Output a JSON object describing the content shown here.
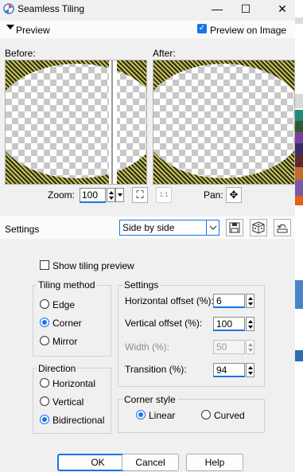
{
  "window": {
    "title": "Seamless Tiling",
    "minimize": "—",
    "maximize": "☐",
    "close": "✕"
  },
  "preview": {
    "section_label": "Preview",
    "preview_on_image_label": "Preview on Image",
    "preview_on_image_checked": true,
    "before_label": "Before:",
    "after_label": "After:",
    "zoom_label": "Zoom:",
    "zoom_value": "100",
    "pan_label": "Pan:",
    "fit_icon": "⛶",
    "one_to_one_icon": "1:1",
    "pan_icon": "✥"
  },
  "settings_bar": {
    "label": "Settings",
    "preset_value": "Side by side",
    "save_icon": "💾",
    "random_icon": "🎲",
    "reset_icon": "↶"
  },
  "options": {
    "show_tiling_preview_label": "Show tiling preview",
    "show_tiling_preview_checked": false,
    "tiling_method": {
      "title": "Tiling method",
      "options": [
        "Edge",
        "Corner",
        "Mirror"
      ],
      "selected": "Corner"
    },
    "direction": {
      "title": "Direction",
      "options": [
        "Horizontal",
        "Vertical",
        "Bidirectional"
      ],
      "selected": "Bidirectional"
    },
    "settings_group": {
      "title": "Settings",
      "horizontal_offset_label": "Horizontal offset (%):",
      "horizontal_offset_value": "6",
      "vertical_offset_label": "Vertical offset (%):",
      "vertical_offset_value": "100",
      "width_label": "Width (%):",
      "width_value": "50",
      "transition_label": "Transition (%):",
      "transition_value": "94"
    },
    "corner_style": {
      "title": "Corner style",
      "options": [
        "Linear",
        "Curved"
      ],
      "selected": "Linear"
    }
  },
  "buttons": {
    "ok": "OK",
    "cancel": "Cancel",
    "help": "Help"
  },
  "colors": {
    "accent": "#1a73e8",
    "pattern_dark": "#2b2b13",
    "pattern_light": "#c9c45a"
  }
}
